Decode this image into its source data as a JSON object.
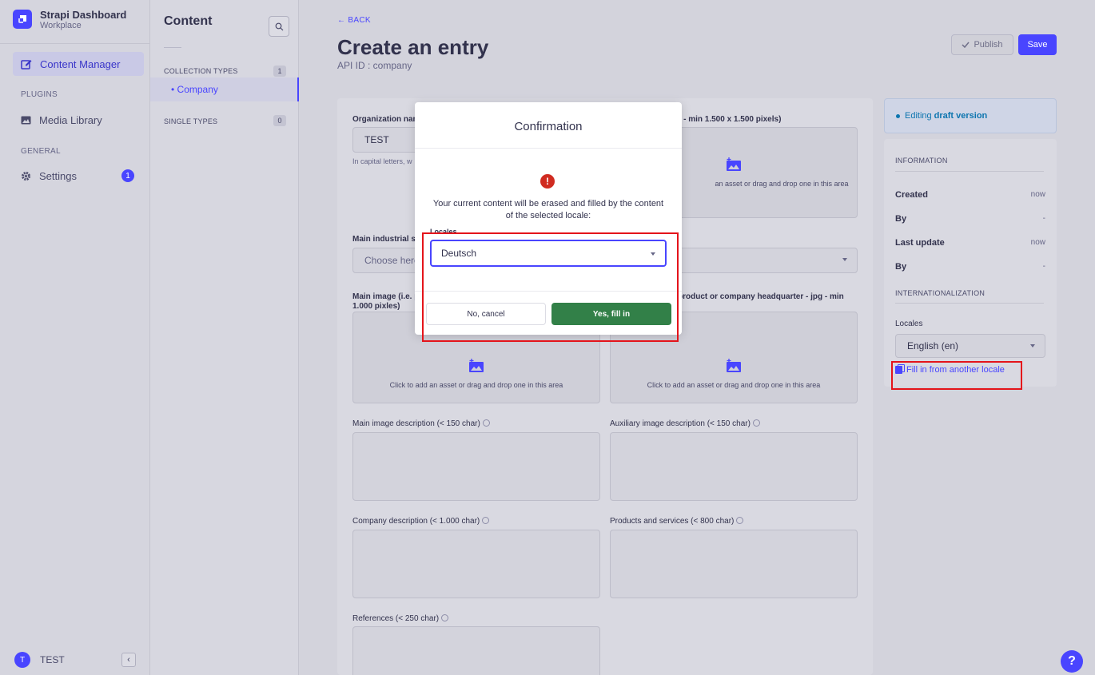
{
  "brand": {
    "title": "Strapi Dashboard",
    "subtitle": "Workplace"
  },
  "mainnav": {
    "content_manager": "Content Manager",
    "plugins_section": "PLUGINS",
    "media_library": "Media Library",
    "general_section": "GENERAL",
    "settings": "Settings",
    "settings_badge": "1",
    "user_initial": "T",
    "user_name": "TEST"
  },
  "subnav": {
    "title": "Content",
    "collection_types": "COLLECTION TYPES",
    "collection_count": "1",
    "company": "• Company",
    "single_types": "SINGLE TYPES",
    "single_count": "0"
  },
  "header": {
    "back": "← BACK",
    "title": "Create an entry",
    "api_id": "API ID : company",
    "publish": "Publish",
    "save": "Save"
  },
  "form": {
    "org_name_label": "Organization nam",
    "org_name_value": "TEST",
    "org_name_hint": "In capital letters, w",
    "logo_label": "ong - min 1.500 x 1.500 pixels)",
    "logo_hint": "an asset or drag and drop one in this area",
    "industrial_label": "Main industrial se",
    "industrial_placeholder": "Choose here",
    "main_image_label_1": "Main image (i.e. p",
    "main_image_label_2": "1.000 pixles)",
    "aux_image_label": "product or company headquarter - jpg - min",
    "main_image_hint": "Click to add an asset or drag and drop one in this area",
    "aux_image_hint": "Click to add an asset or drag and drop one in this area",
    "main_image_desc_label": "Main image description (< 150 char)",
    "aux_image_desc_label": "Auxiliary image description (< 150 char)",
    "company_desc_label": "Company description (< 1.000 char)",
    "products_label": "Products and services (< 800 char)",
    "references_label": "References (< 250 char)"
  },
  "side": {
    "draft_prefix": "Editing ",
    "draft_bold": "draft version",
    "information": "INFORMATION",
    "created_k": "Created",
    "created_v": "now",
    "by1_k": "By",
    "by1_v": "-",
    "updated_k": "Last update",
    "updated_v": "now",
    "by2_k": "By",
    "by2_v": "-",
    "i18n": "INTERNATIONALIZATION",
    "locales_label": "Locales",
    "locale_value": "English (en)",
    "fill_link": "Fill in from another locale"
  },
  "modal": {
    "title": "Confirmation",
    "message": "Your current content will be erased and filled by the content of the selected locale:",
    "locales_label": "Locales",
    "selected_locale": "Deutsch",
    "cancel": "No, cancel",
    "confirm": "Yes, fill in"
  },
  "help": "?",
  "colors": {
    "primary": "#4945ff",
    "success": "#328048",
    "danger": "#d02b20",
    "highlight": "#e4141b"
  }
}
